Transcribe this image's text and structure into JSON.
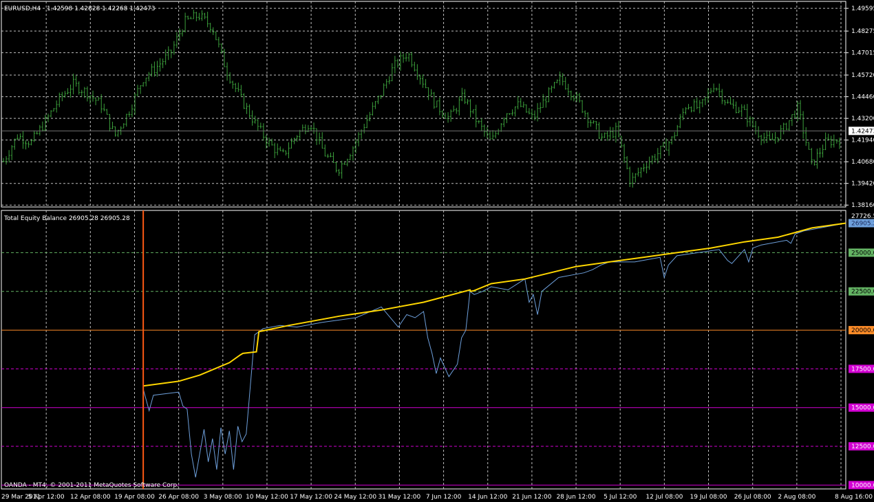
{
  "title": {
    "symbol_tf": "EURUSD,H4",
    "ohlc": "1.42598 1.42828 1.42268 1.42473"
  },
  "indicator": {
    "label": "Total Equity Balance 26905.28 26905.28"
  },
  "copyright": "OANDA - MT4, © 2001-2011 MetaQuotes Software Corp.",
  "colors": {
    "background": "#000000",
    "grid": "#c0c0c0",
    "candles": "#3ca03c",
    "balance": "#ffd700",
    "equity": "#6ea0dc",
    "level_20000": "#ff8c28",
    "levels_magenta": "#d200d2",
    "levels_green": "#64b464",
    "deposit_marker": "#ff5a14",
    "price_box": "#ffffff",
    "balance_box": "#6ea0dc"
  },
  "chart_data": [
    {
      "type": "candlestick",
      "symbol": "EURUSD",
      "timeframe": "H4",
      "ylim": [
        1.3805,
        1.5
      ],
      "y_ticks": [
        "1.49595",
        "1.48275",
        "1.47015",
        "1.45720",
        "1.44460",
        "1.43200",
        "1.41940",
        "1.40680",
        "1.39420",
        "1.38160"
      ],
      "current_price": "1.42473",
      "x_ticks": [
        "29 Mar 2011",
        "5 Apr 12:00",
        "12 Apr 08:00",
        "19 Apr 08:00",
        "26 Apr 08:00",
        "3 May 08:00",
        "10 May 12:00",
        "17 May 12:00",
        "24 May 12:00",
        "31 May 12:00",
        "7 Jun 12:00",
        "14 Jun 12:00",
        "21 Jun 12:00",
        "28 Jun 12:00",
        "5 Jul 12:00",
        "12 Jul 08:00",
        "19 Jul 08:00",
        "26 Jul 08:00",
        "2 Aug 08:00",
        "8 Aug 16:00"
      ],
      "grid": true,
      "close_anchors": [
        1.407,
        1.422,
        1.418,
        1.43,
        1.443,
        1.452,
        1.447,
        1.44,
        1.422,
        1.436,
        1.455,
        1.462,
        1.47,
        1.488,
        1.492,
        1.485,
        1.46,
        1.444,
        1.43,
        1.418,
        1.41,
        1.422,
        1.43,
        1.412,
        1.402,
        1.414,
        1.43,
        1.445,
        1.462,
        1.47,
        1.455,
        1.44,
        1.432,
        1.445,
        1.43,
        1.418,
        1.435,
        1.44,
        1.432,
        1.445,
        1.455,
        1.445,
        1.432,
        1.42,
        1.425,
        1.395,
        1.405,
        1.412,
        1.42,
        1.44,
        1.438,
        1.452,
        1.44,
        1.437,
        1.425,
        1.418,
        1.426,
        1.438,
        1.405,
        1.418,
        1.42
      ]
    },
    {
      "type": "line",
      "title": "Total Equity Balance",
      "values_label": "26905.28 26905.28",
      "ylim": [
        9750,
        27726.5
      ],
      "y_ticks": [
        "27726.5",
        "25000.0",
        "22500.0",
        "20000.0",
        "17500.0",
        "15000.0",
        "12500.0",
        "10000.0"
      ],
      "levels": [
        {
          "value": 25000,
          "style": "dashed",
          "color": "green"
        },
        {
          "value": 22500,
          "style": "dashed",
          "color": "green"
        },
        {
          "value": 20000,
          "style": "solid",
          "color": "orange"
        },
        {
          "value": 17500,
          "style": "dashed",
          "color": "magenta"
        },
        {
          "value": 15000,
          "style": "solid",
          "color": "magenta"
        },
        {
          "value": 12500,
          "style": "dashed",
          "color": "magenta"
        },
        {
          "value": 10000,
          "style": "solid",
          "color": "magenta"
        }
      ],
      "balance_box": "26905.2",
      "series": [
        {
          "name": "Balance",
          "x_frac": [
            0.168,
            0.21,
            0.235,
            0.27,
            0.283,
            0.286,
            0.302,
            0.305,
            0.34,
            0.4,
            0.45,
            0.5,
            0.555,
            0.556,
            0.56,
            0.58,
            0.62,
            0.65,
            0.68,
            0.72,
            0.76,
            0.8,
            0.84,
            0.88,
            0.92,
            0.96,
            1.0
          ],
          "values": [
            16400,
            16700,
            17100,
            17900,
            18400,
            18500,
            18600,
            19900,
            20300,
            20900,
            21300,
            21800,
            22600,
            22500,
            22550,
            23000,
            23300,
            23700,
            24100,
            24400,
            24700,
            25000,
            25300,
            25700,
            26000,
            26600,
            26905
          ]
        },
        {
          "name": "Equity",
          "x_frac": [
            0.168,
            0.175,
            0.18,
            0.21,
            0.215,
            0.22,
            0.225,
            0.23,
            0.24,
            0.245,
            0.25,
            0.255,
            0.26,
            0.265,
            0.27,
            0.275,
            0.28,
            0.285,
            0.29,
            0.3,
            0.31,
            0.33,
            0.35,
            0.38,
            0.42,
            0.45,
            0.47,
            0.48,
            0.49,
            0.5,
            0.505,
            0.51,
            0.515,
            0.52,
            0.53,
            0.54,
            0.545,
            0.55,
            0.555,
            0.56,
            0.57,
            0.58,
            0.6,
            0.62,
            0.625,
            0.63,
            0.635,
            0.64,
            0.66,
            0.69,
            0.7,
            0.71,
            0.72,
            0.75,
            0.78,
            0.785,
            0.79,
            0.8,
            0.85,
            0.86,
            0.865,
            0.87,
            0.88,
            0.885,
            0.89,
            0.9,
            0.93,
            0.935,
            0.94,
            0.95,
            0.97,
            1.0
          ],
          "values": [
            16200,
            14800,
            15800,
            16000,
            15100,
            14900,
            12000,
            10500,
            13600,
            11500,
            13000,
            11000,
            13700,
            12000,
            13500,
            11000,
            13800,
            12800,
            13300,
            19700,
            20100,
            20300,
            20200,
            20500,
            20800,
            21500,
            20200,
            21000,
            20800,
            21200,
            19500,
            18500,
            17200,
            18200,
            17000,
            17800,
            19500,
            20000,
            22500,
            22300,
            22500,
            22800,
            22600,
            23300,
            21800,
            22300,
            21000,
            22500,
            23400,
            23700,
            23900,
            24200,
            24400,
            24400,
            24700,
            23400,
            24200,
            24800,
            25200,
            24500,
            24300,
            24600,
            25200,
            24400,
            25300,
            25500,
            25800,
            25600,
            26200,
            26400,
            26600,
            26905
          ]
        }
      ],
      "deposit_marker_x_frac": 0.168
    }
  ]
}
